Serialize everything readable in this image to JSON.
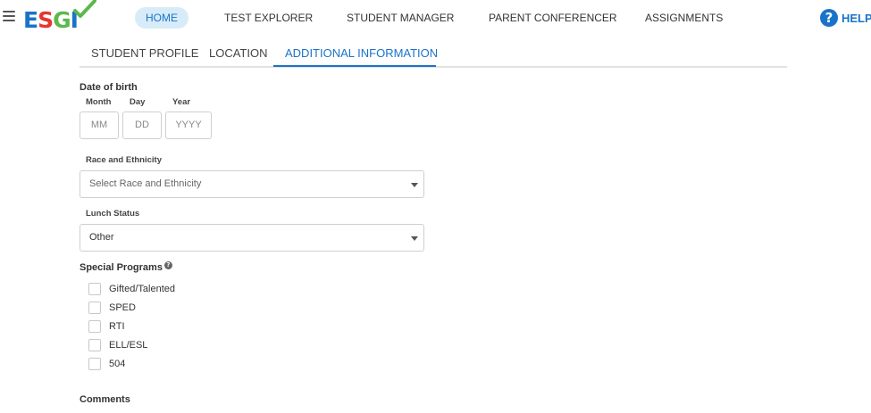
{
  "app": {
    "logo_text": [
      "E",
      "S",
      "G",
      "I"
    ]
  },
  "nav": {
    "items": [
      {
        "label": "HOME",
        "active": true
      },
      {
        "label": "TEST EXPLORER",
        "active": false
      },
      {
        "label": "STUDENT MANAGER",
        "active": false
      },
      {
        "label": "PARENT CONFERENCER",
        "active": false
      },
      {
        "label": "ASSIGNMENTS",
        "active": false
      }
    ],
    "help_label": "HELP",
    "help_icon_glyph": "?"
  },
  "tabs": [
    {
      "label": "STUDENT PROFILE",
      "active": false
    },
    {
      "label": "LOCATION",
      "active": false
    },
    {
      "label": "ADDITIONAL INFORMATION",
      "active": true
    }
  ],
  "form": {
    "dob": {
      "label": "Date of birth",
      "month_label": "Month",
      "day_label": "Day",
      "year_label": "Year",
      "month_placeholder": "MM",
      "day_placeholder": "DD",
      "year_placeholder": "YYYY"
    },
    "race": {
      "label": "Race and Ethnicity",
      "value": "Select Race and Ethnicity"
    },
    "lunch": {
      "label": "Lunch Status",
      "value": "Other"
    },
    "special_programs": {
      "label": "Special Programs",
      "help_glyph": "?",
      "options": [
        {
          "label": "Gifted/Talented",
          "checked": false
        },
        {
          "label": "SPED",
          "checked": false
        },
        {
          "label": "RTI",
          "checked": false
        },
        {
          "label": "ELL/ESL",
          "checked": false
        },
        {
          "label": "504",
          "checked": false
        }
      ]
    },
    "comments": {
      "label": "Comments"
    }
  },
  "colors": {
    "accent": "#1a73c9",
    "nav_active_bg": "#d7ecf8",
    "logo_red": "#e8352e",
    "logo_green": "#5cb84c"
  }
}
